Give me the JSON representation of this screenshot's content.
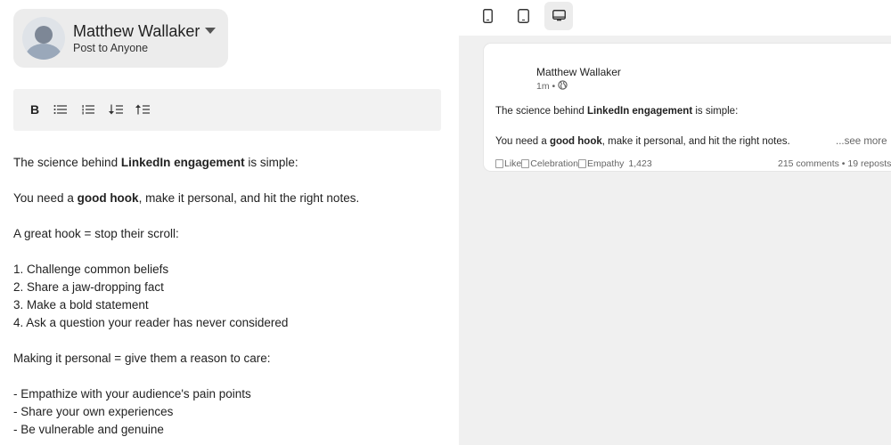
{
  "author": {
    "name": "Matthew Wallaker",
    "audience": "Post to Anyone"
  },
  "toolbar": {
    "bold_label": "B",
    "icons": [
      "bullet-list-icon",
      "numbered-list-icon",
      "sort-descending-icon",
      "sort-ascending-icon"
    ]
  },
  "editor": {
    "line1_pre": "The science behind ",
    "line1_bold": "LinkedIn engagement",
    "line1_post": " is simple:",
    "line2_pre": "You need a ",
    "line2_bold": "good hook",
    "line2_post": ", make it personal, and hit the right notes.",
    "line3": "A great hook = stop their scroll:",
    "list1": [
      "1. Challenge common beliefs",
      "2. Share a jaw-dropping fact",
      "3. Make a bold statement",
      "4. Ask a question your reader has never considered"
    ],
    "line4": "Making it personal = give them a reason to care:",
    "list2": [
      "- Empathize with your audience's pain points",
      "- Share your own experiences",
      "- Be vulnerable and genuine"
    ]
  },
  "devices": {
    "icons": [
      "mobile-icon",
      "tablet-icon",
      "desktop-icon"
    ],
    "active": "desktop"
  },
  "preview": {
    "name": "Matthew Wallaker",
    "time": "1m •",
    "line1_pre": "The science behind ",
    "line1_bold": "LinkedIn engagement",
    "line1_post": " is simple:",
    "line2_pre": "You need a ",
    "line2_bold": "good hook",
    "line2_post": ", make it personal, and hit the right notes.",
    "see_more": "...see more",
    "reactions": [
      "Like",
      "Celebration",
      "Empathy"
    ],
    "reaction_count": "1,423",
    "stats": "215 comments • 19 reposts"
  }
}
